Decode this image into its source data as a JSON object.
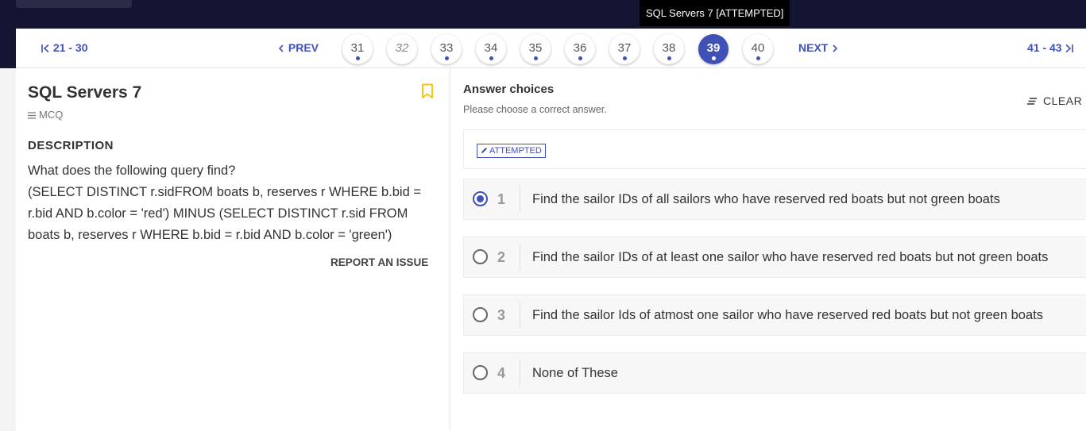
{
  "tooltip": "SQL Servers 7 [ATTEMPTED]",
  "nav": {
    "prev_range": "21 - 30",
    "prev": "PREV",
    "next": "NEXT",
    "next_range": "41 - 43",
    "questions": [
      "31",
      "32",
      "33",
      "34",
      "35",
      "36",
      "37",
      "38",
      "39",
      "40"
    ],
    "current": "39"
  },
  "question": {
    "title": "SQL Servers 7",
    "type": "MCQ",
    "description_label": "DESCRIPTION",
    "description_lines": [
      "What does the following query find?",
      "(SELECT DISTINCT r.sidFROM boats b, reserves r WHERE b.bid =",
      "r.bid AND b.color = 'red') MINUS (SELECT DISTINCT r.sid FROM",
      "boats b, reserves r WHERE b.bid = r.bid AND b.color = 'green')"
    ],
    "report": "REPORT AN ISSUE"
  },
  "answers": {
    "title": "Answer choices",
    "subtitle": "Please choose a correct answer.",
    "clear": "CLEAR",
    "status": "ATTEMPTED",
    "choices": [
      {
        "num": "1",
        "text": "Find the sailor IDs of all sailors who have reserved red boats but not green boats"
      },
      {
        "num": "2",
        "text": "Find the sailor IDs of at least one sailor who have reserved red boats but not green boats"
      },
      {
        "num": "3",
        "text": "Find the sailor Ids of atmost one sailor who have reserved red boats but not green boats"
      },
      {
        "num": "4",
        "text": "None of These"
      }
    ],
    "selected": "1"
  },
  "colors": {
    "accent": "#3f51b5",
    "topbar": "#141532",
    "bookmark": "#f2c811"
  }
}
